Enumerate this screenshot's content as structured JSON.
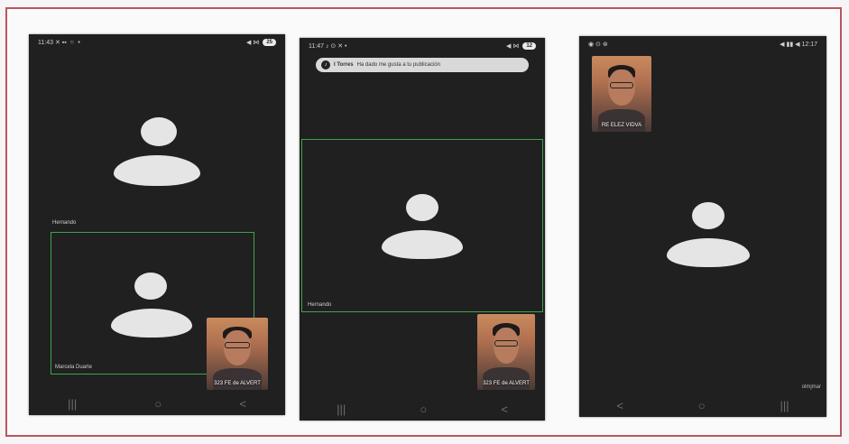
{
  "screens": [
    {
      "status_time": "11:43",
      "status_icons": "✕ ▪▪ ◾ •",
      "status_right": "◀ ⋈",
      "badge": "25",
      "top_participant": "Hernando",
      "bottom_participant": "Marcela Duarte",
      "self_caption": "323 FE de ALVERT",
      "nav": [
        "|||",
        "○",
        "<"
      ]
    },
    {
      "status_time": "11:47",
      "status_icons": "♪ ⊙ ✕ •",
      "status_right": "◀ ⋈",
      "badge": "12",
      "toast_name": "I Torres",
      "toast_text": "Ha dado me gusta a tu publicación",
      "main_participant": "Hernando",
      "self_caption": "323 FE de ALVERT",
      "nav": [
        "|||",
        "○",
        "<"
      ]
    },
    {
      "status_left": "◉ ⊙ ⊛",
      "status_right": "◀ ▮▮ ◀ 12:17",
      "self_caption": "RE ELEZ VIDVA",
      "corner_label": "olmjmar",
      "nav": [
        "<",
        "○",
        "|||"
      ]
    }
  ],
  "colors": {
    "frame_border": "#b8575f",
    "active_tile_border": "#3fa34d",
    "screen_bg": "#202020",
    "avatar": "#e5e5e5"
  }
}
